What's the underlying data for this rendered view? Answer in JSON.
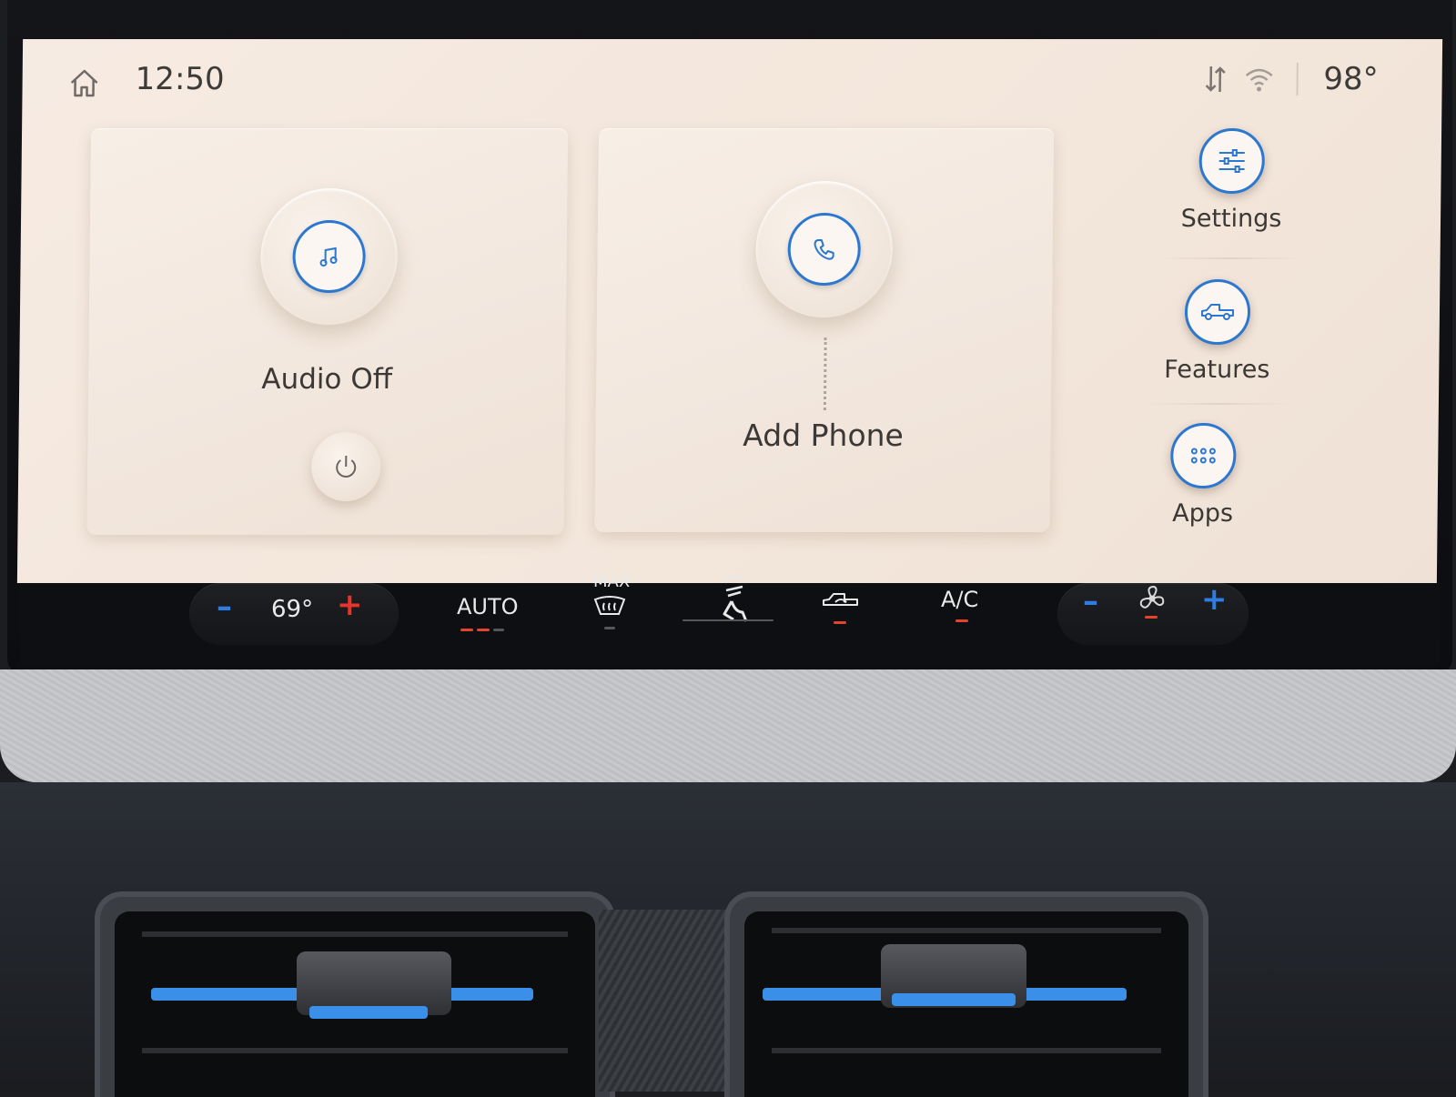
{
  "status_bar": {
    "time": "12:50",
    "outside_temp": "98°",
    "icons": [
      "home-icon",
      "data-transfer-icon",
      "wifi-icon"
    ]
  },
  "audio_card": {
    "icon": "music-note-icon",
    "label": "Audio Off",
    "power_icon": "power-icon"
  },
  "phone_card": {
    "icon": "phone-icon",
    "label": "Add Phone"
  },
  "side_menu": {
    "items": [
      {
        "label": "Settings",
        "icon": "sliders-icon"
      },
      {
        "label": "Features",
        "icon": "truck-icon"
      },
      {
        "label": "Apps",
        "icon": "apps-grid-icon"
      }
    ]
  },
  "climate": {
    "driver_temp": "69°",
    "auto_label": "AUTO",
    "max_label": "MAX",
    "ac_label": "A/C",
    "icons": [
      "minus-icon",
      "plus-icon",
      "max-defrost-icon",
      "seat-airflow-icon",
      "recirculation-icon",
      "fan-icon"
    ],
    "colors": {
      "active_indicator": "#e5442c",
      "accent_blue": "#2f7de0"
    }
  }
}
